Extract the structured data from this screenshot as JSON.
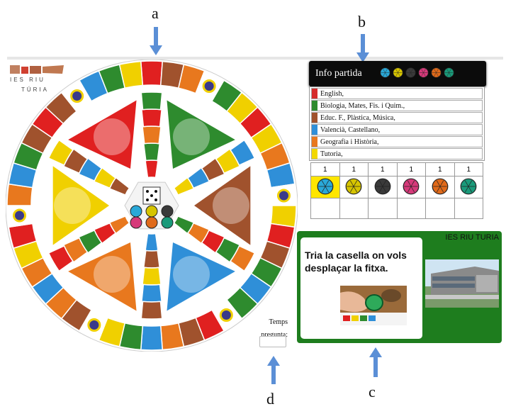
{
  "annotations": {
    "a": "a",
    "b": "b",
    "c": "c",
    "d": "d"
  },
  "logo": {
    "line1": "IES RIU",
    "line2": "TÚRIA"
  },
  "info": {
    "title": "Info partida",
    "token_colors": [
      "#2aa8d8",
      "#d6c400",
      "#3a3a3a",
      "#d63a7a",
      "#e06a1a",
      "#1a9a7a"
    ]
  },
  "categories": [
    {
      "color": "#d62b2b",
      "label": "English,"
    },
    {
      "color": "#2e8b2e",
      "label": "Biologia, Mates, Fis. i Quim.,"
    },
    {
      "color": "#a0522d",
      "label": "Educ. F., Plàstica, Música,"
    },
    {
      "color": "#2f8fd8",
      "label": "Valencià, Castellano,"
    },
    {
      "color": "#e8781e",
      "label": "Geografia i Història,"
    },
    {
      "color": "#f2d800",
      "label": "Tutoria,"
    }
  ],
  "scores": [
    "1",
    "1",
    "1",
    "1",
    "1",
    "1"
  ],
  "question": {
    "school": "IES RIU TURIA",
    "text": "Tria la casella on vols desplaçar la fitxa."
  },
  "timer": {
    "label": "Temps pregunta:",
    "value": ""
  },
  "board": {
    "icon_names": [
      "globe-hands",
      "discobolus-statue",
      "rolling-stones-tongue",
      "gladiator-warrior",
      "students-group",
      "flags-portrait"
    ]
  }
}
